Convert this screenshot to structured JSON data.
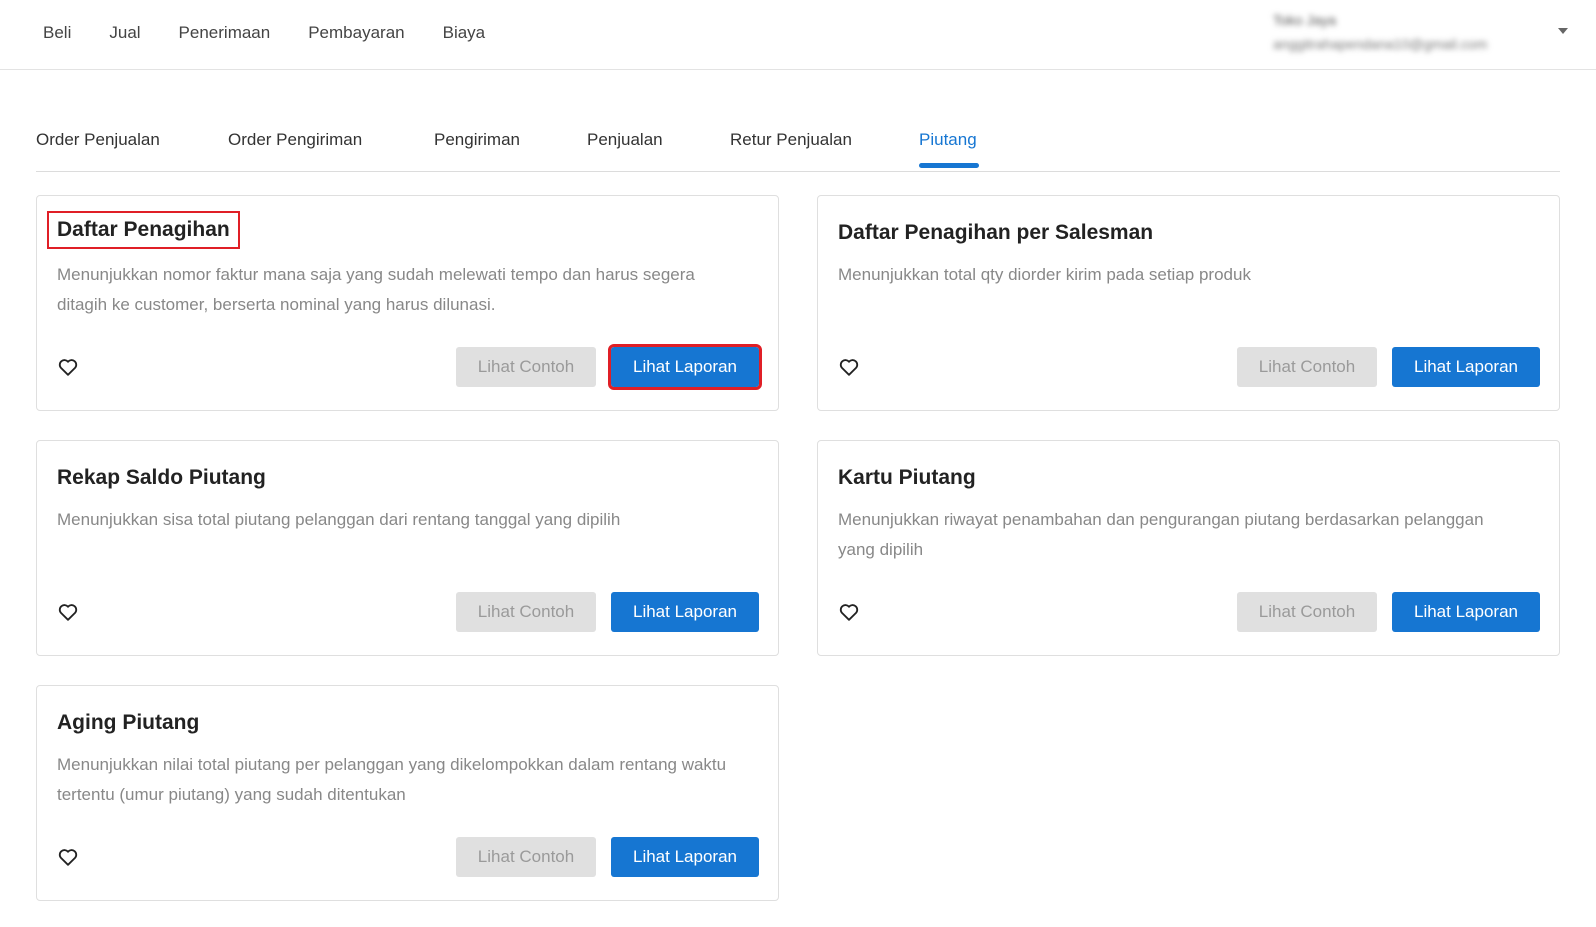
{
  "topnav": {
    "items": [
      {
        "label": "Beli"
      },
      {
        "label": "Jual"
      },
      {
        "label": "Penerimaan"
      },
      {
        "label": "Pembayaran"
      },
      {
        "label": "Biaya"
      }
    ]
  },
  "user": {
    "name": "Toko Jaya",
    "email": "anggitrahapendana10@gmail.com"
  },
  "tabs": [
    {
      "label": "Order Penjualan"
    },
    {
      "label": "Order Pengiriman"
    },
    {
      "label": "Pengiriman"
    },
    {
      "label": "Penjualan"
    },
    {
      "label": "Retur Penjualan"
    },
    {
      "label": "Piutang",
      "active": true
    }
  ],
  "colors": {
    "accent": "#1676d2",
    "highlight": "#e01f26",
    "disabled_button": "#e0e0e0"
  },
  "icons": {
    "favorite": "heart-icon",
    "user_menu": "caret-down-icon"
  },
  "buttons": {
    "sample": "Lihat Contoh",
    "report": "Lihat Laporan"
  },
  "reports": [
    {
      "title": "Daftar Penagihan",
      "description": "Menunjukkan nomor faktur mana saja yang sudah melewati tempo dan harus segera ditagih ke customer, berserta nominal yang harus dilunasi."
    },
    {
      "title": "Daftar Penagihan per Salesman",
      "description": "Menunjukkan total qty diorder kirim pada setiap produk"
    },
    {
      "title": "Rekap Saldo Piutang",
      "description": "Menunjukkan sisa total piutang pelanggan dari rentang tanggal yang dipilih"
    },
    {
      "title": "Kartu Piutang",
      "description": "Menunjukkan riwayat penambahan dan pengurangan piutang berdasarkan pelanggan yang dipilih"
    },
    {
      "title": "Aging Piutang",
      "description": "Menunjukkan nilai total piutang per pelanggan yang dikelompokkan dalam rentang waktu tertentu (umur piutang) yang sudah ditentukan"
    }
  ]
}
